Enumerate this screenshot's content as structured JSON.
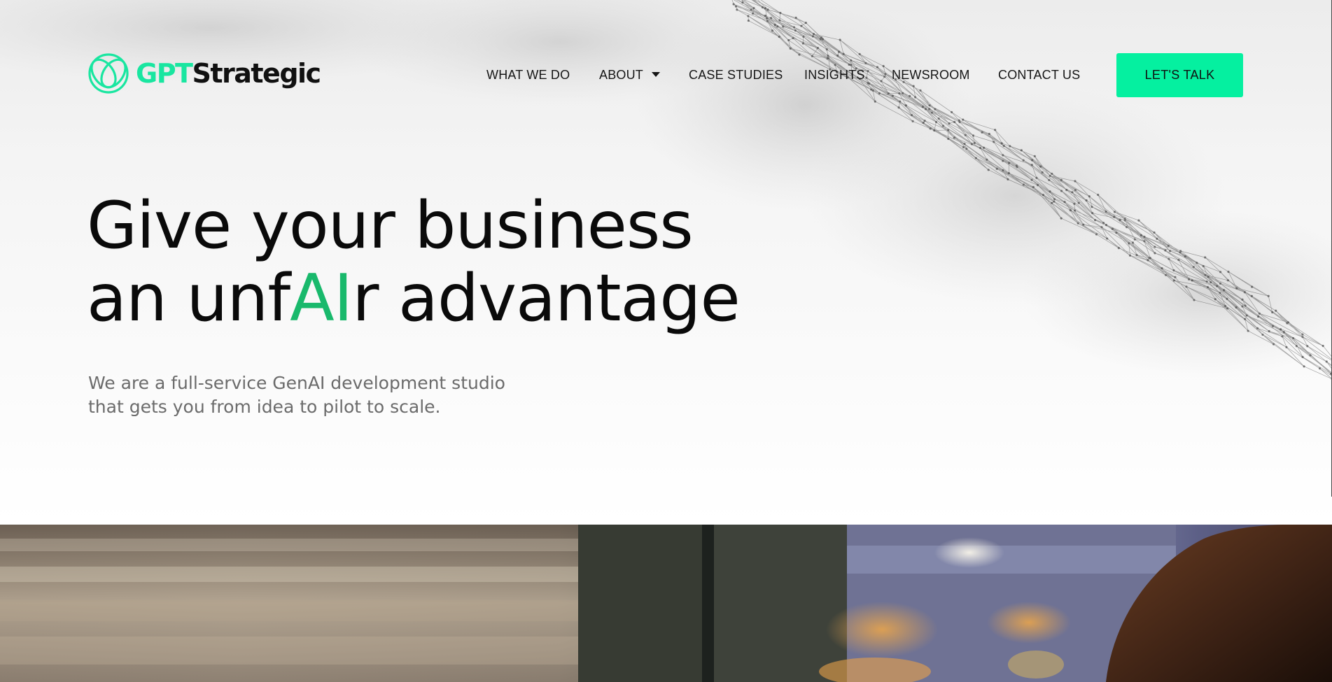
{
  "brand": {
    "name_part1": "GPT",
    "name_part2": "Strategic",
    "accent_color": "#19e6a0",
    "logo_icon": "interlocking-rings-icon"
  },
  "nav": {
    "items": [
      {
        "label": "WHAT WE DO",
        "has_dropdown": false
      },
      {
        "label": "ABOUT",
        "has_dropdown": true
      },
      {
        "label": "CASE STUDIES",
        "has_dropdown": false
      },
      {
        "label": "INSIGHTS",
        "has_dropdown": false
      },
      {
        "label": "NEWSROOM",
        "has_dropdown": false
      },
      {
        "label": "CONTACT US",
        "has_dropdown": false
      }
    ],
    "cta_label": "LET'S TALK",
    "cta_color": "#05f0a0"
  },
  "hero": {
    "headline_line1": "Give your business",
    "headline_line2_pre": "an unf",
    "headline_line2_accent": "AI",
    "headline_line2_post": "r advantage",
    "headline_accent_color": "#19b96c",
    "subtext_line1": "We are a full-service GenAI development studio",
    "subtext_line2": "that gets you from idea to pilot to scale."
  },
  "photo": {
    "description_icon": "office-photo"
  }
}
